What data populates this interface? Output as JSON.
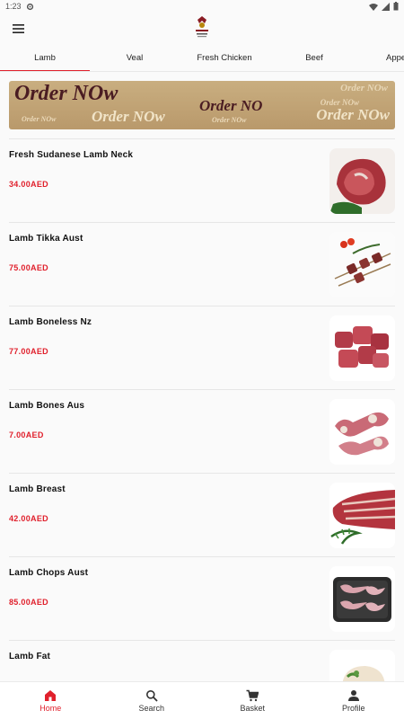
{
  "status_bar": {
    "time": "1:23"
  },
  "tabs": [
    {
      "label": "Lamb",
      "active": true
    },
    {
      "label": "Veal",
      "active": false
    },
    {
      "label": "Fresh Chicken",
      "active": false
    },
    {
      "label": "Beef",
      "active": false
    },
    {
      "label": "Appet",
      "active": false
    }
  ],
  "banner": {
    "texts": [
      "Order NOw",
      "Order NOw",
      "Order NO",
      "Order NOw",
      "Order NOw",
      "Order NOw",
      "Order NOw",
      "Order NOw"
    ]
  },
  "products": [
    {
      "name": "Fresh Sudanese Lamb Neck",
      "price": "34.00AED"
    },
    {
      "name": "Lamb Tikka Aust",
      "price": "75.00AED"
    },
    {
      "name": "Lamb Boneless Nz",
      "price": "77.00AED"
    },
    {
      "name": "Lamb Bones Aus",
      "price": "7.00AED"
    },
    {
      "name": "Lamb Breast",
      "price": "42.00AED"
    },
    {
      "name": "Lamb Chops Aust",
      "price": "85.00AED"
    },
    {
      "name": "Lamb Fat",
      "price": ""
    }
  ],
  "bottom_nav": [
    {
      "label": "Home",
      "icon": "home-icon",
      "active": true
    },
    {
      "label": "Search",
      "icon": "search-icon",
      "active": false
    },
    {
      "label": "Basket",
      "icon": "basket-icon",
      "active": false
    },
    {
      "label": "Profile",
      "icon": "profile-icon",
      "active": false
    }
  ],
  "colors": {
    "accent": "#e0202c",
    "banner": "#bfa273"
  }
}
